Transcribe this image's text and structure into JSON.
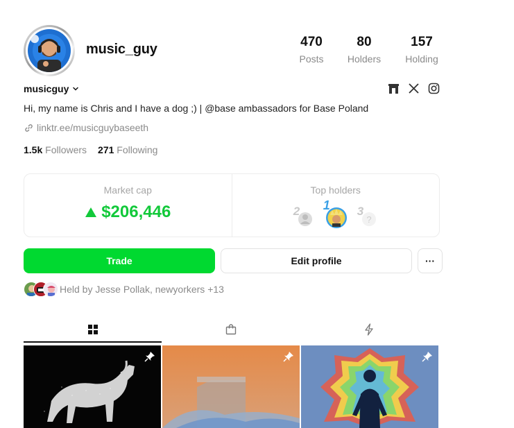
{
  "profile": {
    "username": "music_guy",
    "handle": "musicguy",
    "bio": "Hi, my name is Chris and I have a dog ;) | @base ambassadors for Base Poland",
    "link": "linktr.ee/musicguybaseeth"
  },
  "stats": {
    "posts": {
      "value": "470",
      "label": "Posts"
    },
    "holders": {
      "value": "80",
      "label": "Holders"
    },
    "holding": {
      "value": "157",
      "label": "Holding"
    }
  },
  "follow": {
    "followers_count": "1.5k",
    "followers_label": "Followers",
    "following_count": "271",
    "following_label": "Following"
  },
  "market": {
    "market_cap_label": "Market cap",
    "market_cap_value": "$206,446",
    "top_holders_label": "Top holders",
    "rank_labels": [
      "2",
      "1",
      "3"
    ],
    "accent_color": "#12c93a"
  },
  "actions": {
    "trade_label": "Trade",
    "edit_label": "Edit profile",
    "more_label": "···"
  },
  "held_by": {
    "text": "Held by Jesse Pollak, newyorkers +13"
  },
  "tabs": [
    {
      "icon": "grid-icon",
      "active": true
    },
    {
      "icon": "shopping-bag-icon",
      "active": false
    },
    {
      "icon": "lightning-icon",
      "active": false
    }
  ],
  "posts": [
    {
      "subject": "white horse",
      "pinned": true
    },
    {
      "subject": "orange building",
      "pinned": true
    },
    {
      "subject": "aura silhouette",
      "pinned": true
    }
  ],
  "socials": [
    "gate-icon",
    "x-icon",
    "instagram-icon"
  ]
}
